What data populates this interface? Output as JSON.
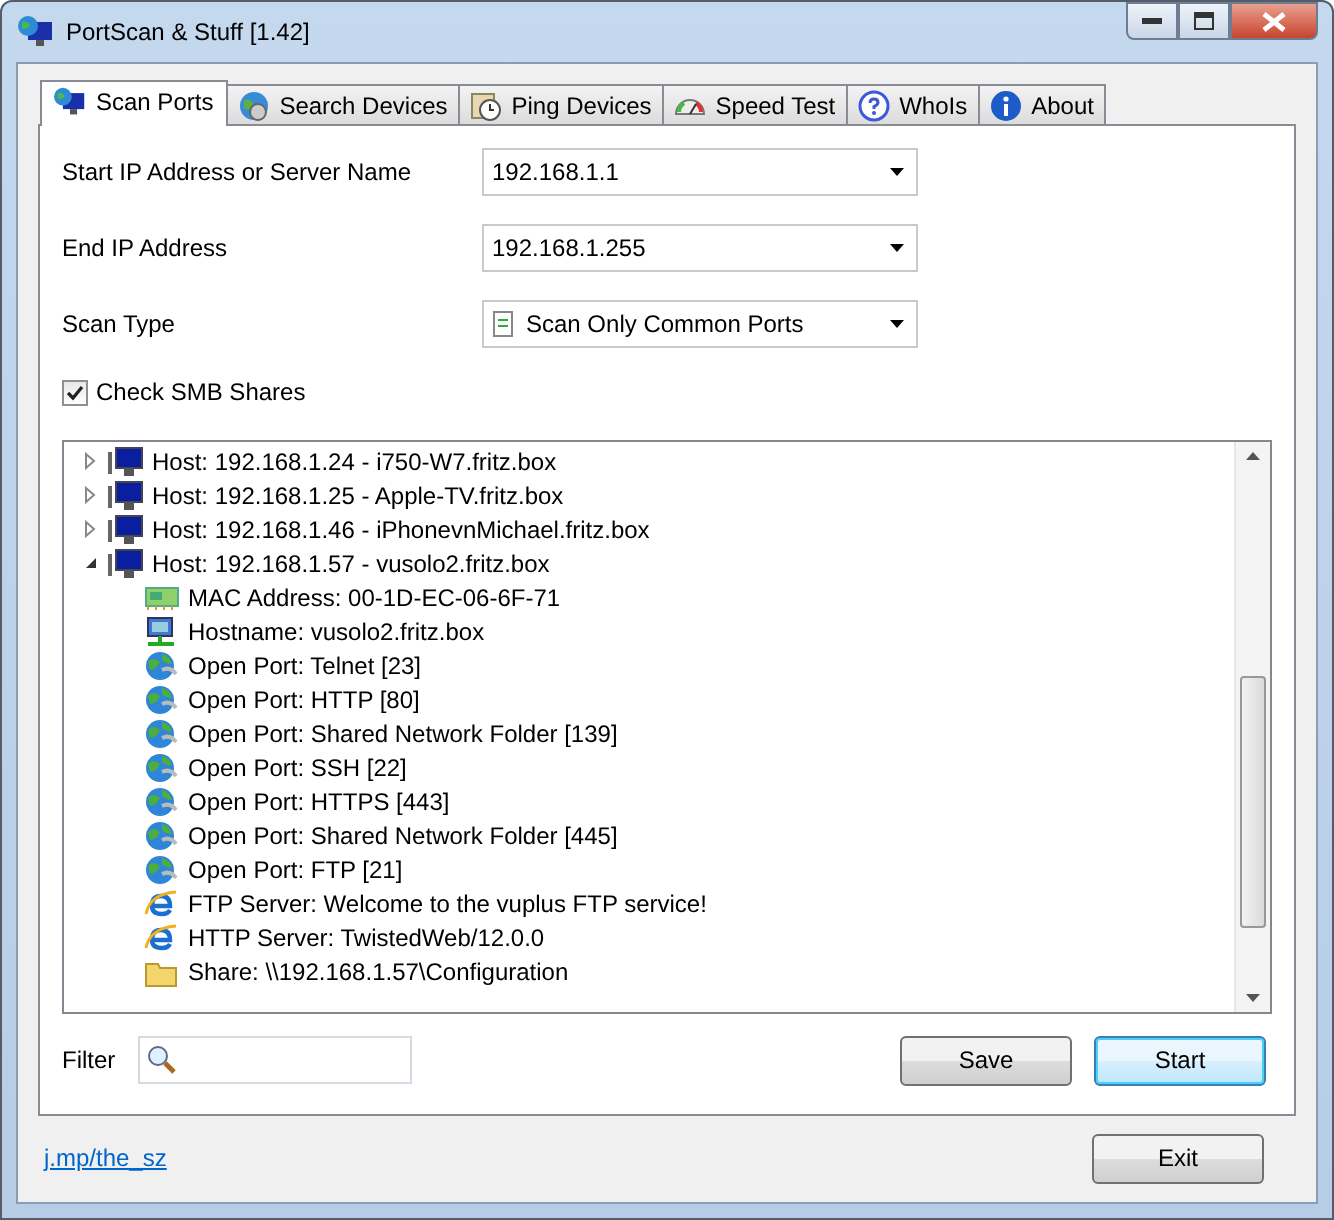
{
  "window": {
    "title": "PortScan & Stuff [1.42]"
  },
  "tabs": [
    {
      "label": "Scan Ports",
      "selected": true
    },
    {
      "label": "Search Devices",
      "selected": false
    },
    {
      "label": "Ping Devices",
      "selected": false
    },
    {
      "label": "Speed Test",
      "selected": false
    },
    {
      "label": "WhoIs",
      "selected": false
    },
    {
      "label": "About",
      "selected": false
    }
  ],
  "form": [
    {
      "label": "Start IP Address or Server Name",
      "value": "192.168.1.1"
    },
    {
      "label": "End IP Address",
      "value": "192.168.1.255"
    },
    {
      "label": "Scan Type",
      "value": "Scan Only Common Ports"
    }
  ],
  "check_smb": {
    "label": "Check SMB Shares",
    "checked": true
  },
  "tree": [
    {
      "label": "Host: 192.168.1.24 - i750-W7.fritz.box",
      "expanded": false
    },
    {
      "label": "Host: 192.168.1.25 - Apple-TV.fritz.box",
      "expanded": false
    },
    {
      "label": "Host: 192.168.1.46 - iPhonevnMichael.fritz.box",
      "expanded": false
    },
    {
      "label": "Host: 192.168.1.57 - vusolo2.fritz.box",
      "expanded": true,
      "children": [
        {
          "kind": "mac",
          "label": "MAC Address: 00-1D-EC-06-6F-71"
        },
        {
          "kind": "hostname",
          "label": "Hostname: vusolo2.fritz.box"
        },
        {
          "kind": "port",
          "label": "Open Port: Telnet [23]"
        },
        {
          "kind": "port",
          "label": "Open Port: HTTP [80]"
        },
        {
          "kind": "port",
          "label": "Open Port: Shared Network Folder [139]"
        },
        {
          "kind": "port",
          "label": "Open Port: SSH [22]"
        },
        {
          "kind": "port",
          "label": "Open Port: HTTPS [443]"
        },
        {
          "kind": "port",
          "label": "Open Port: Shared Network Folder [445]"
        },
        {
          "kind": "port",
          "label": "Open Port: FTP [21]"
        },
        {
          "kind": "server",
          "label": "FTP Server: Welcome to the vuplus FTP service!"
        },
        {
          "kind": "server",
          "label": "HTTP Server: TwistedWeb/12.0.0"
        },
        {
          "kind": "share",
          "label": "Share: \\\\192.168.1.57\\Configuration"
        }
      ]
    }
  ],
  "filter": {
    "label": "Filter"
  },
  "buttons": [
    {
      "label": "Save",
      "default": false
    },
    {
      "label": "Start",
      "default": true
    }
  ],
  "link": "j.mp/the_sz",
  "exit_button": "Exit"
}
